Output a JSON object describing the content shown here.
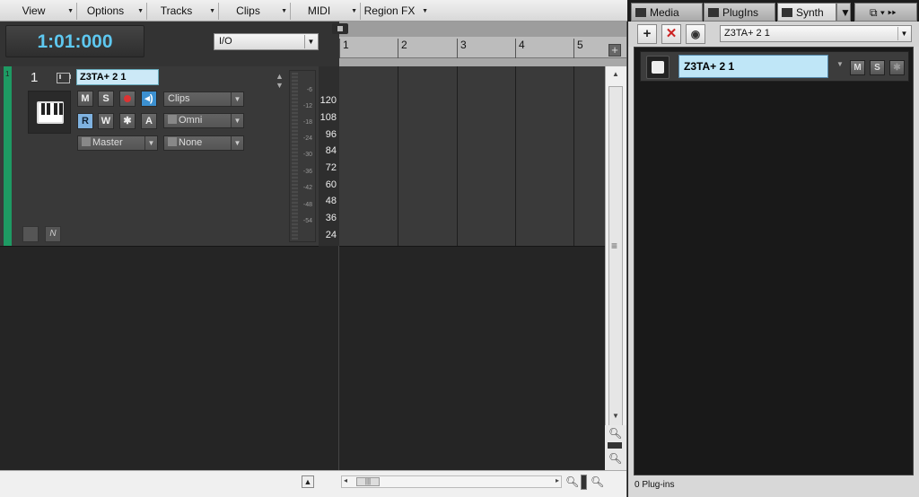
{
  "menubar": {
    "items": [
      "View",
      "Options",
      "Tracks",
      "Clips",
      "MIDI",
      "Region FX"
    ]
  },
  "transport": {
    "time": "1:01:000",
    "io_label": "I/O"
  },
  "ruler": {
    "marks": [
      "1",
      "2",
      "3",
      "4",
      "5"
    ]
  },
  "track": {
    "number": "1",
    "name": "Z3TA+ 2 1",
    "buttons": {
      "mute": "M",
      "solo": "S",
      "read": "R",
      "write": "W",
      "freeze": "✱",
      "archive": "A"
    },
    "input": "Clips",
    "midi_channel": "Omni",
    "output": "Master",
    "patch": "None",
    "meter_labels": [
      "-6",
      "-12",
      "-18",
      "-24",
      "-30",
      "-36",
      "-42",
      "-48",
      "-54"
    ],
    "piano_axis": [
      "120",
      "108",
      "96",
      "84",
      "72",
      "60",
      "48",
      "36",
      "24"
    ]
  },
  "right_panel": {
    "tabs": [
      "Media",
      "PlugIns",
      "Synth"
    ],
    "synth_select": "Z3TA+ 2 1",
    "rack": {
      "instrument_name": "Z3TA+ 2 1",
      "buttons": [
        "M",
        "S",
        "✱"
      ]
    },
    "status": "0 Plug-ins"
  },
  "colors": {
    "time_display": "#5ec8f0",
    "track_strip": "#1e9a63",
    "name_field": "#cce9f7",
    "echo_button": "#3c90d0"
  }
}
